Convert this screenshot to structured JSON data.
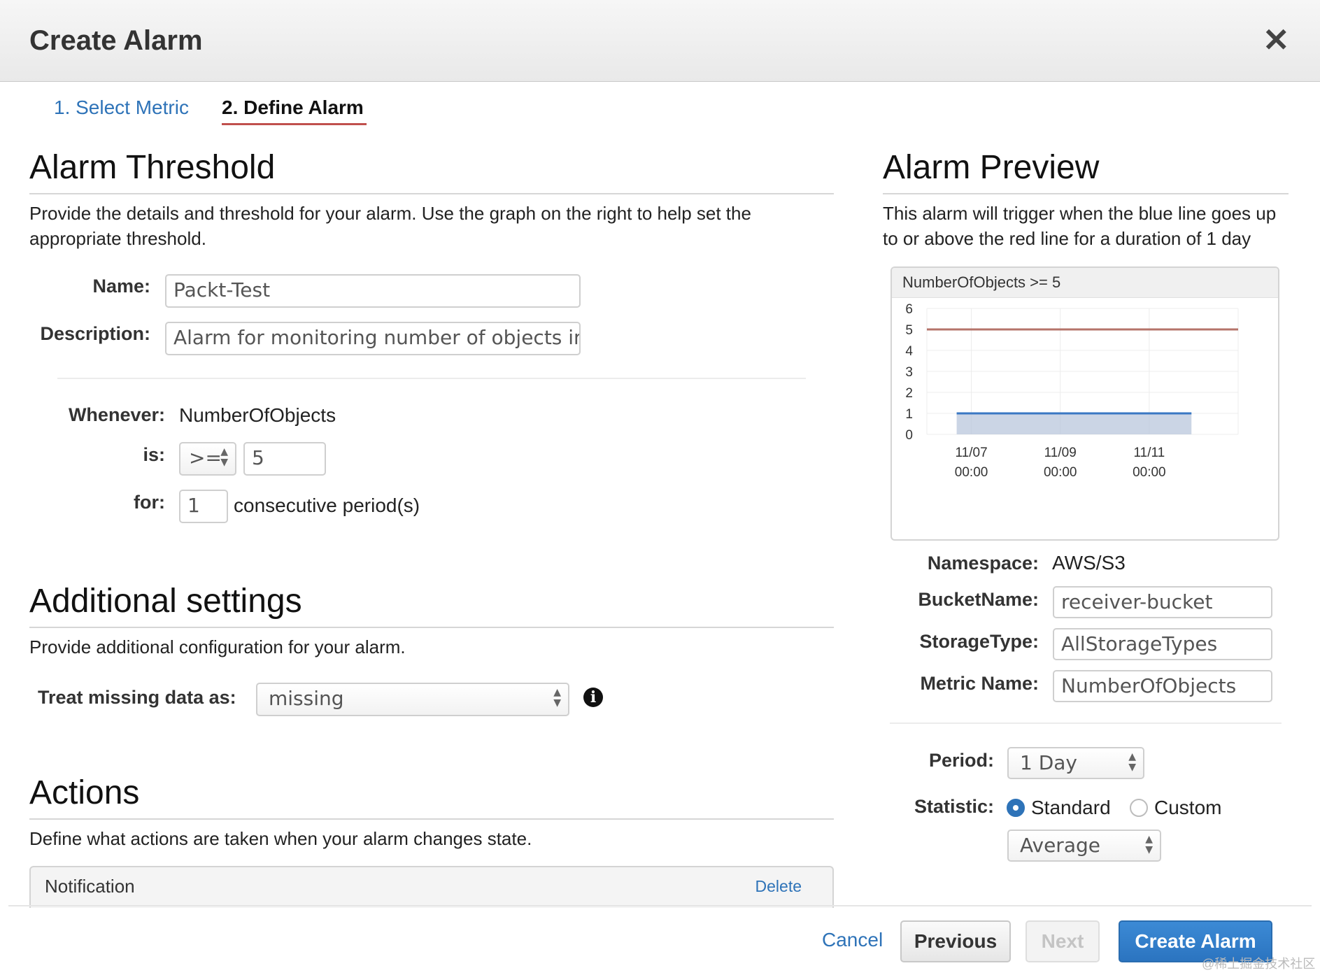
{
  "dialog": {
    "title": "Create Alarm"
  },
  "steps": {
    "step1": "1. Select Metric",
    "step2": "2. Define Alarm"
  },
  "threshold": {
    "heading": "Alarm Threshold",
    "description": "Provide the details and threshold for your alarm. Use the graph on the right to help set the appropriate threshold.",
    "name_label": "Name:",
    "name_value": "Packt-Test",
    "description_label": "Description:",
    "description_value": "Alarm for monitoring number of objects in b",
    "whenever_label": "Whenever:",
    "whenever_value": "NumberOfObjects",
    "is_label": "is:",
    "operator": ">=",
    "threshold_value": "5",
    "for_label": "for:",
    "periods_value": "1",
    "periods_suffix": "consecutive period(s)"
  },
  "additional": {
    "heading": "Additional settings",
    "description": "Provide additional configuration for your alarm.",
    "missing_label": "Treat missing data as:",
    "missing_value": "missing",
    "info_icon": "info-icon"
  },
  "actions": {
    "heading": "Actions",
    "description": "Define what actions are taken when your alarm changes state.",
    "notification_title": "Notification",
    "delete_label": "Delete"
  },
  "preview": {
    "heading": "Alarm Preview",
    "description": "This alarm will trigger when the blue line goes up to or above the red line for a duration of 1 day",
    "namespace_label": "Namespace:",
    "namespace_value": "AWS/S3",
    "bucket_label": "BucketName:",
    "bucket_value": "receiver-bucket",
    "storage_label": "StorageType:",
    "storage_value": "AllStorageTypes",
    "metric_label": "Metric Name:",
    "metric_value": "NumberOfObjects",
    "period_label": "Period:",
    "period_value": "1 Day",
    "statistic_label": "Statistic:",
    "standard_label": "Standard",
    "custom_label": "Custom",
    "statistic_selected": "Standard",
    "statistic_value": "Average"
  },
  "chart_data": {
    "type": "line",
    "title": "NumberOfObjects >= 5",
    "y_ticks": [
      "6",
      "5",
      "4",
      "3",
      "2",
      "1",
      "0"
    ],
    "ylim": [
      0,
      6
    ],
    "xlim": [
      0,
      7
    ],
    "x_ticks": [
      {
        "line1": "11/07",
        "line2": "00:00",
        "x": 1
      },
      {
        "line1": "11/09",
        "line2": "00:00",
        "x": 3
      },
      {
        "line1": "11/11",
        "line2": "00:00",
        "x": 5
      }
    ],
    "threshold": {
      "value": 5,
      "color": "#b5736a"
    },
    "series": [
      {
        "x_start": 0.67,
        "x_end": 5.95,
        "value": 1,
        "color": "#3a78c3"
      }
    ],
    "grid": true
  },
  "footer": {
    "cancel_label": "Cancel",
    "previous_label": "Previous",
    "next_label": "Next",
    "create_label": "Create Alarm",
    "watermark": "@稀土掘金技术社区"
  }
}
